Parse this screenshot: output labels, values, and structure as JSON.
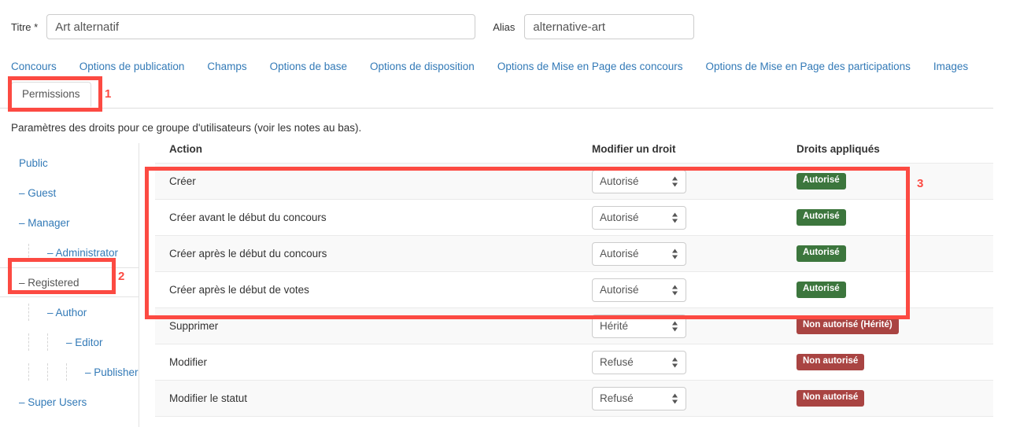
{
  "form": {
    "title_label": "Titre *",
    "title_value": "Art alternatif",
    "title_placeholder": "",
    "alias_label": "Alias",
    "alias_value": "alternative-art",
    "alias_placeholder": ""
  },
  "tabs": {
    "row1": [
      {
        "label": "Concours"
      },
      {
        "label": "Options de publication"
      },
      {
        "label": "Champs"
      },
      {
        "label": "Options de base"
      },
      {
        "label": "Options de disposition"
      },
      {
        "label": "Options de Mise en Page des concours"
      },
      {
        "label": "Options de Mise en Page des participations"
      },
      {
        "label": "Images"
      }
    ],
    "active": {
      "label": "Permissions"
    }
  },
  "description": "Paramètres des droits pour ce groupe d'utilisateurs (voir les notes au bas).",
  "sidebar": {
    "items": [
      {
        "label": "Public",
        "level": 0,
        "active": false
      },
      {
        "label": "– Guest",
        "level": 1,
        "active": false
      },
      {
        "label": "– Manager",
        "level": 1,
        "active": false
      },
      {
        "label": "– Administrator",
        "level": 2,
        "active": false
      },
      {
        "label": "– Registered",
        "level": 1,
        "active": true
      },
      {
        "label": "– Author",
        "level": 2,
        "active": false
      },
      {
        "label": "– Editor",
        "level": 3,
        "active": false
      },
      {
        "label": "– Publisher",
        "level": 4,
        "active": false
      },
      {
        "label": "– Super Users",
        "level": 1,
        "active": false
      }
    ]
  },
  "table": {
    "headers": {
      "action": "Action",
      "set_permission": "Modifier un droit",
      "applied": "Droits appliqués"
    },
    "select_options": [
      "Hérité",
      "Autorisé",
      "Refusé"
    ],
    "rows": [
      {
        "action": "Créer",
        "setting": "Autorisé",
        "applied": "Autorisé",
        "applied_state": "green"
      },
      {
        "action": "Créer avant le début du concours",
        "setting": "Autorisé",
        "applied": "Autorisé",
        "applied_state": "green"
      },
      {
        "action": "Créer après le début du concours",
        "setting": "Autorisé",
        "applied": "Autorisé",
        "applied_state": "green"
      },
      {
        "action": "Créer après le début de votes",
        "setting": "Autorisé",
        "applied": "Autorisé",
        "applied_state": "green"
      },
      {
        "action": "Supprimer",
        "setting": "Hérité",
        "applied": "Non autorisé (Hérité)",
        "applied_state": "red"
      },
      {
        "action": "Modifier",
        "setting": "Refusé",
        "applied": "Non autorisé",
        "applied_state": "red"
      },
      {
        "action": "Modifier le statut",
        "setting": "Refusé",
        "applied": "Non autorisé",
        "applied_state": "red"
      }
    ]
  },
  "annotations": {
    "color": "#fc4a42",
    "markers": [
      {
        "number": "1"
      },
      {
        "number": "2"
      },
      {
        "number": "3"
      }
    ]
  }
}
